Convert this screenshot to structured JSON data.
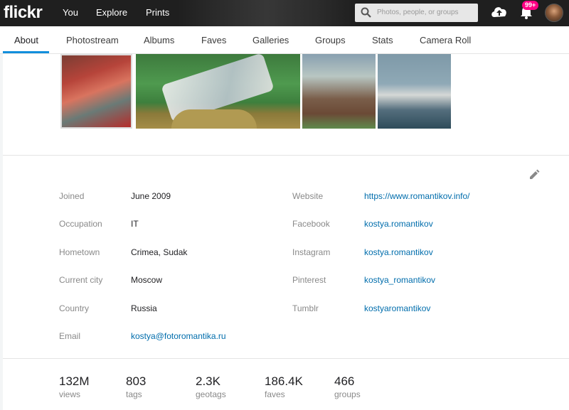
{
  "topbar": {
    "logo": "flickr",
    "nav": [
      "You",
      "Explore",
      "Prints"
    ],
    "search_placeholder": "Photos, people, or groups",
    "notification_badge": "99+",
    "icons": [
      "search-icon",
      "upload-icon",
      "bell-icon",
      "avatar"
    ]
  },
  "tabs": [
    "About",
    "Photostream",
    "Albums",
    "Faves",
    "Galleries",
    "Groups",
    "Stats",
    "Camera Roll"
  ],
  "active_tab": "About",
  "profile": {
    "left": [
      {
        "label": "Joined",
        "value": "June 2009"
      },
      {
        "label": "Occupation",
        "value": "IT"
      },
      {
        "label": "Hometown",
        "value": "Crimea, Sudak"
      },
      {
        "label": "Current city",
        "value": "Moscow"
      },
      {
        "label": "Country",
        "value": "Russia"
      },
      {
        "label": "Email",
        "value": "kostya@fotoromantika.ru"
      }
    ],
    "right": [
      {
        "label": "Website",
        "value": "https://www.romantikov.info/"
      },
      {
        "label": "Facebook",
        "value": "kostya.romantikov"
      },
      {
        "label": "Instagram",
        "value": "kostya.romantikov"
      },
      {
        "label": "Pinterest",
        "value": "kostya_romantikov"
      },
      {
        "label": "Tumblr",
        "value": "kostyaromantikov"
      }
    ]
  },
  "stats": [
    {
      "value": "132M",
      "label": "views"
    },
    {
      "value": "803",
      "label": "tags"
    },
    {
      "value": "2.3K",
      "label": "geotags"
    },
    {
      "value": "186.4K",
      "label": "faves"
    },
    {
      "value": "466",
      "label": "groups"
    }
  ],
  "colors": {
    "topbar_bg": "#1f1f1f",
    "accent_tab": "#128fdc",
    "link": "#006dac",
    "badge": "#ff0084"
  }
}
